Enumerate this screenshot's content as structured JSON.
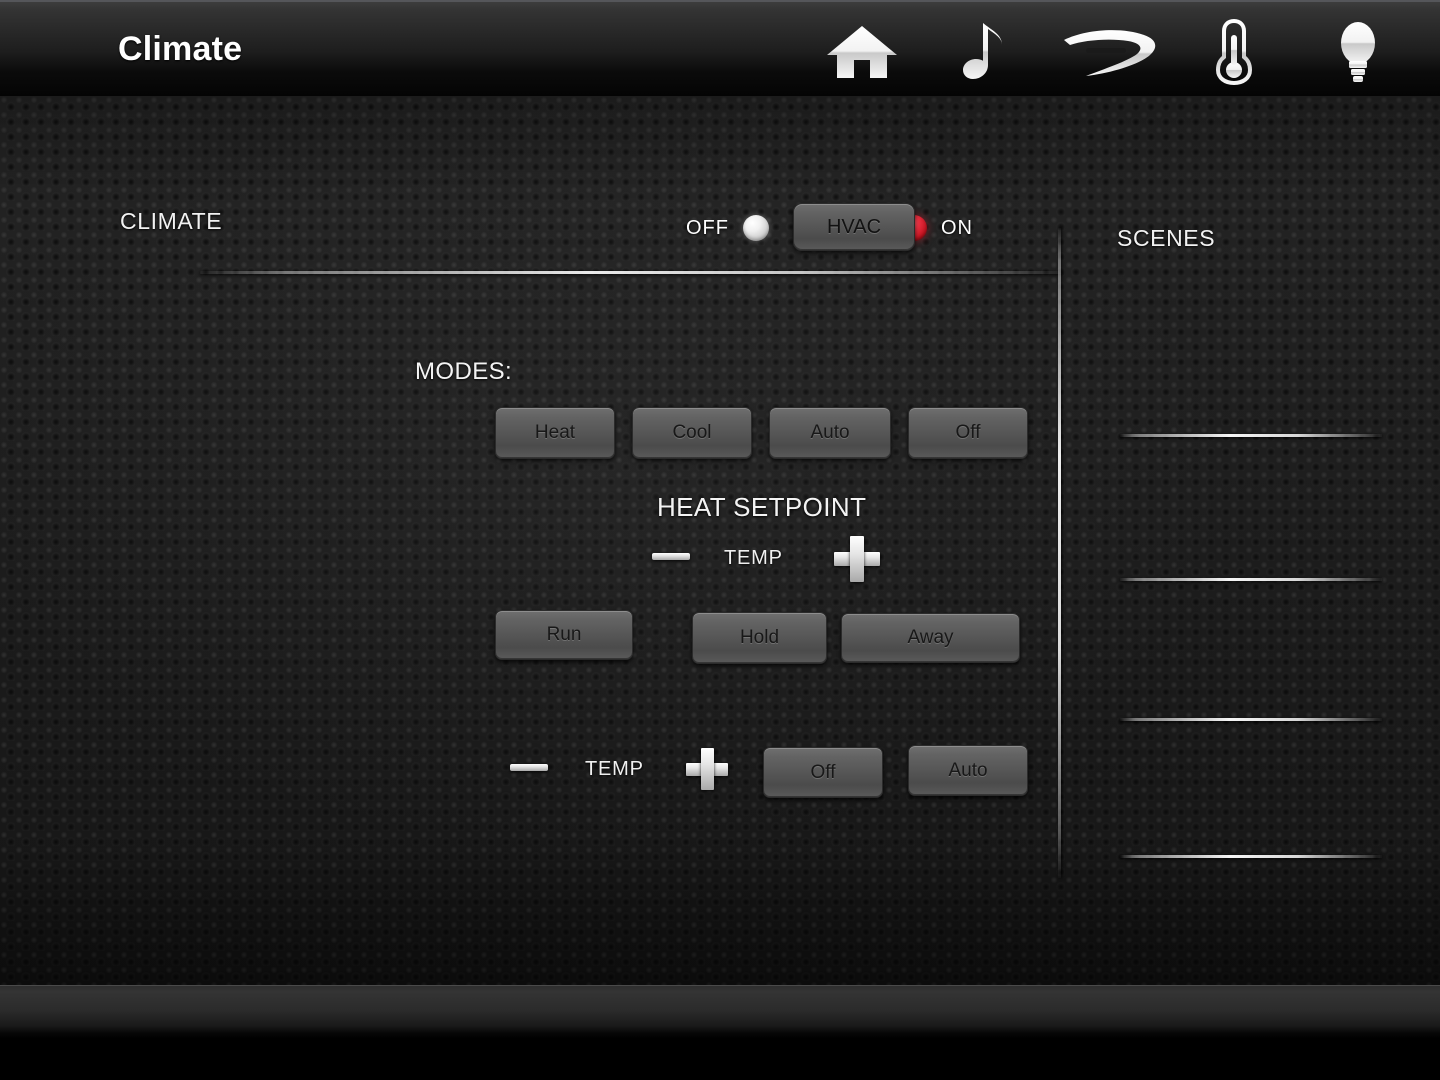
{
  "titlebar": {
    "title": "Climate",
    "icons": [
      {
        "name": "home-icon",
        "label": "Home"
      },
      {
        "name": "music-note-icon",
        "label": "Music"
      },
      {
        "name": "bluray-icon",
        "label": "Blu-ray"
      },
      {
        "name": "thermometer-icon",
        "label": "Climate"
      },
      {
        "name": "lightbulb-icon",
        "label": "Lights"
      }
    ]
  },
  "climate": {
    "section_title": "CLIMATE",
    "hvac": {
      "off_label": "OFF",
      "on_label": "ON",
      "button_label": "HVAC",
      "off_led_color": "#f0f0f0",
      "on_led_color": "#d42030",
      "state": "ON"
    },
    "modes": {
      "label": "MODES:",
      "buttons": [
        {
          "label": "Heat"
        },
        {
          "label": "Cool"
        },
        {
          "label": "Auto"
        },
        {
          "label": "Off"
        }
      ]
    },
    "heat_setpoint": {
      "title": "HEAT SETPOINT",
      "decrease_label": "minus",
      "temp_label": "TEMP",
      "increase_label": "plus"
    },
    "schedule_buttons": [
      {
        "label": "Run"
      },
      {
        "label": "Hold"
      },
      {
        "label": "Away"
      }
    ],
    "cool_setpoint": {
      "decrease_label": "minus",
      "temp_label": "TEMP",
      "increase_label": "plus"
    },
    "fan_buttons": [
      {
        "label": "Off"
      },
      {
        "label": "Auto"
      }
    ]
  },
  "scenes": {
    "section_title": "SCENES",
    "rows": [
      {
        "label": ""
      },
      {
        "label": ""
      },
      {
        "label": ""
      },
      {
        "label": ""
      }
    ]
  }
}
